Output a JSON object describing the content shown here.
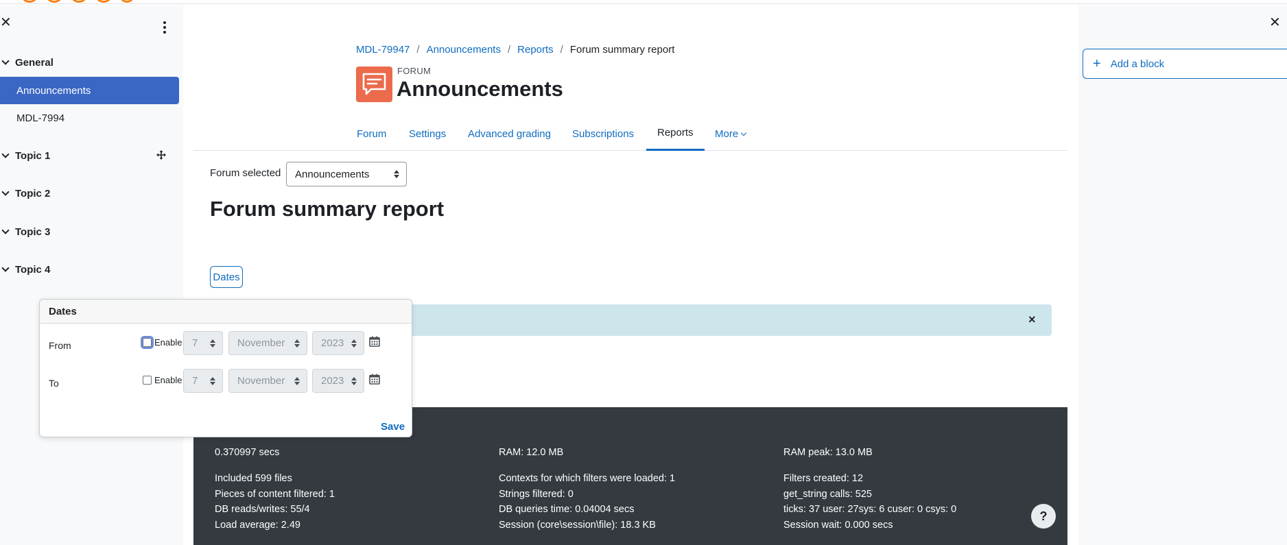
{
  "left_drawer": {
    "sections": [
      {
        "label": "General"
      },
      {
        "label": "Topic 1"
      },
      {
        "label": "Topic 2"
      },
      {
        "label": "Topic 3"
      },
      {
        "label": "Topic 4"
      }
    ],
    "items": [
      {
        "label": "Announcements",
        "active": true
      },
      {
        "label": "MDL-7994",
        "active": false
      }
    ]
  },
  "breadcrumb": [
    "MDL-79947",
    "Announcements",
    "Reports",
    "Forum summary report"
  ],
  "header": {
    "module_label": "FORUM",
    "title": "Announcements"
  },
  "tabs": [
    {
      "label": "Forum"
    },
    {
      "label": "Settings"
    },
    {
      "label": "Advanced grading"
    },
    {
      "label": "Subscriptions"
    },
    {
      "label": "Reports",
      "active": true
    },
    {
      "label": "More"
    }
  ],
  "forum_select": {
    "label": "Forum selected",
    "value": "Announcements"
  },
  "report_title": "Forum summary report",
  "dates_button": "Dates",
  "dates_popover": {
    "title": "Dates",
    "from": {
      "label": "From",
      "enable_label": "Enable",
      "day": "7",
      "month": "November",
      "year": "2023"
    },
    "to": {
      "label": "To",
      "enable_label": "Enable",
      "day": "7",
      "month": "November",
      "year": "2023"
    },
    "save_label": "Save"
  },
  "footer": {
    "col1": [
      "0.370997 secs",
      "Included 599 files",
      "Pieces of content filtered: 1",
      "DB reads/writes: 55/4",
      "Load average: 2.49"
    ],
    "col2": [
      "RAM: 12.0 MB",
      "Contexts for which filters were loaded: 1",
      "Strings filtered: 0",
      "DB queries time: 0.04004 secs",
      "Session (core\\session\\file): 18.3 KB"
    ],
    "col3": [
      "RAM peak: 13.0 MB",
      "Filters created: 12",
      "get_string calls: 525",
      "ticks: 37 user: 27sys: 6 cuser: 0 csys: 0",
      "Session wait: 0.000 secs"
    ]
  },
  "help_label": "?",
  "right_drawer": {
    "add_block_label": "Add a block"
  },
  "colors": {
    "accent": "#0f6cbf",
    "active_nav": "#3a66c4",
    "forum_icon": "#eb6b4c",
    "footer_bg": "#343a40",
    "alert_bg": "#cde6ec"
  }
}
